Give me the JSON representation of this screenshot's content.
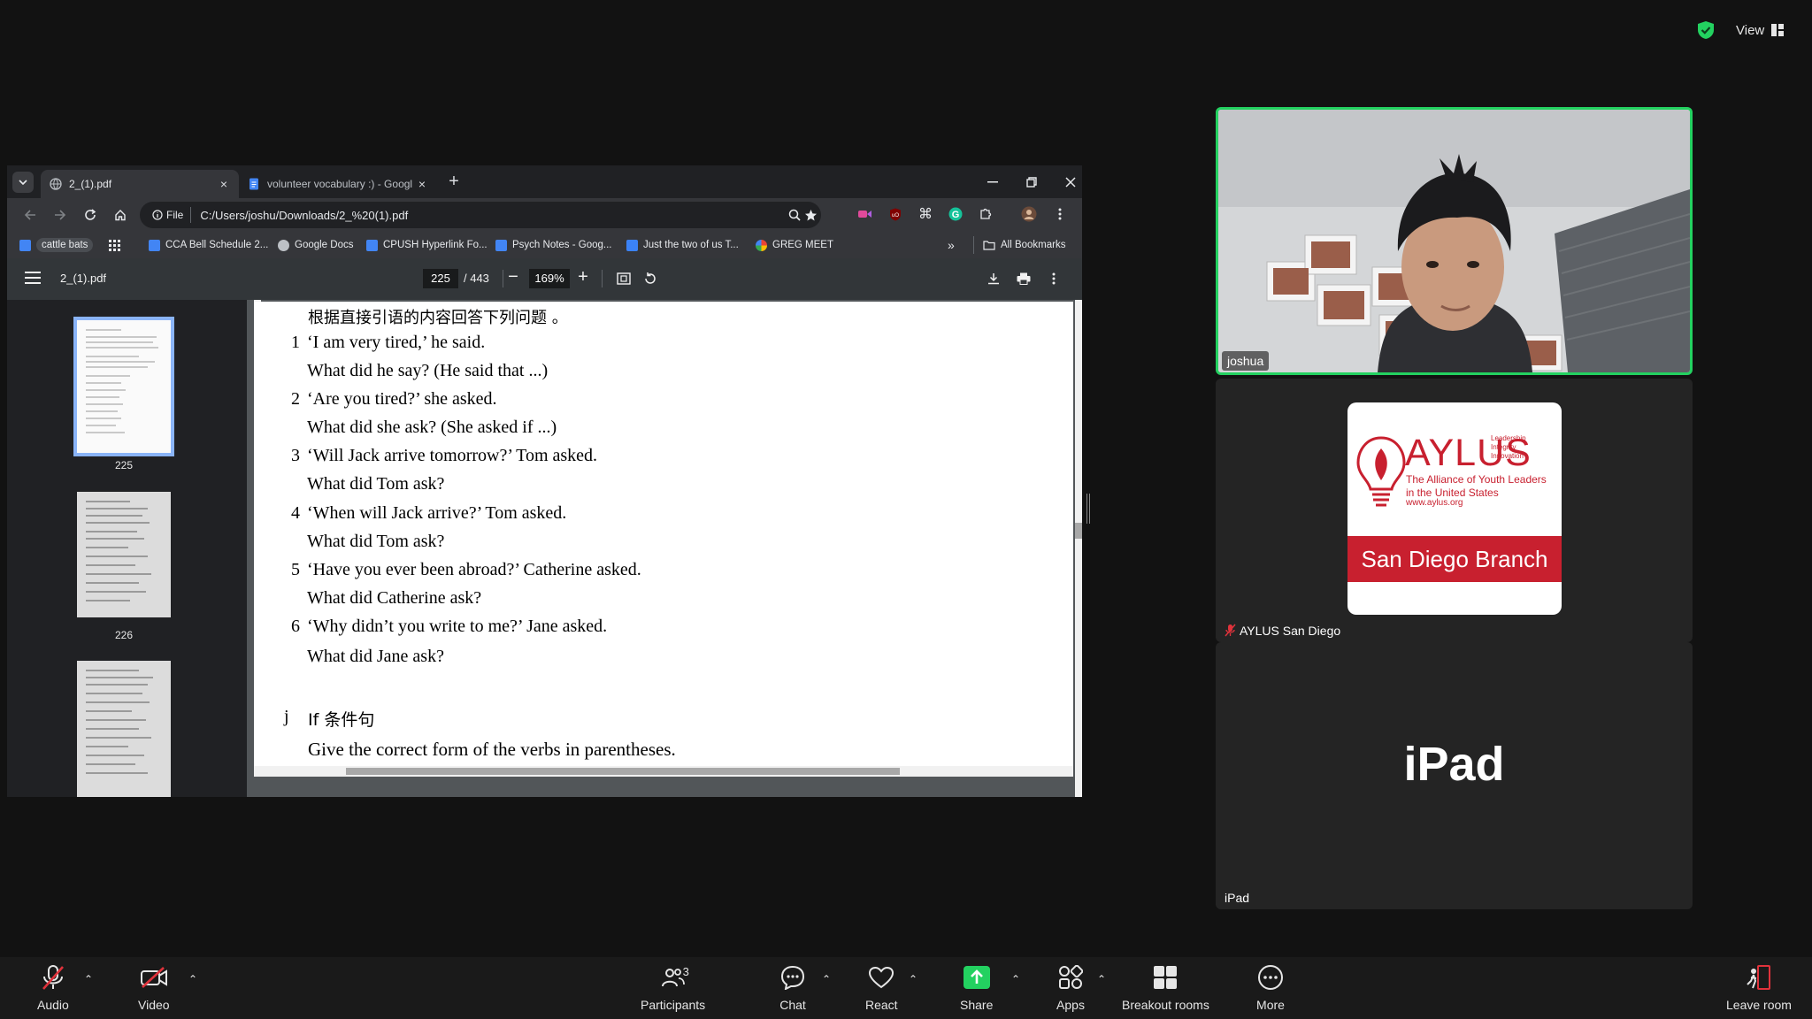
{
  "top_right": {
    "view_label": "View"
  },
  "browser": {
    "tabs": [
      {
        "title": "2_(1).pdf"
      },
      {
        "title": "volunteer vocabulary :) - Googl"
      }
    ],
    "omnibox": {
      "scheme_chip": "File",
      "url": "C:/Users/joshu/Downloads/2_%20(1).pdf"
    },
    "bookmarks": [
      "cattle bats",
      "CCA Bell Schedule 2...",
      "Google Docs",
      "CPUSH Hyperlink Fo...",
      "Psych Notes - Goog...",
      "Just the two of us T...",
      "GREG MEET"
    ],
    "all_bookmarks_label": "All Bookmarks",
    "more_bookmarks": "»"
  },
  "pdf": {
    "filename": "2_(1).pdf",
    "page_current": "225",
    "page_total": "/ 443",
    "zoom": "169%",
    "thumbnails": [
      "225",
      "226"
    ],
    "content": {
      "heading": "根据直接引语的内容回答下列问题 。",
      "items": [
        {
          "num": "1",
          "quote": "‘I am very tired,’ he said.",
          "question": "What did he say? (He said that ...)"
        },
        {
          "num": "2",
          "quote": "‘Are you tired?’ she asked.",
          "question": "What did she ask? (She asked if ...)"
        },
        {
          "num": "3",
          "quote": "‘Will Jack arrive tomorrow?’ Tom asked.",
          "question": "What did Tom ask?"
        },
        {
          "num": "4",
          "quote": "‘When will Jack arrive?’ Tom asked.",
          "question": "What did Tom ask?"
        },
        {
          "num": "5",
          "quote": "‘Have you ever been abroad?’ Catherine asked.",
          "question": "What did Catherine ask?"
        },
        {
          "num": "6",
          "quote": "‘Why didn’t you write to me?’ Jane asked.",
          "question": "What did Jane ask?"
        }
      ],
      "section_letter": "j",
      "section_title": "If 条件句",
      "instruction": "Give the correct form of the verbs in parentheses."
    }
  },
  "participants": {
    "camera": {
      "name": "joshua"
    },
    "aylus": {
      "name": "AYLUS San Diego",
      "logo_title": "AYLUS",
      "logo_tagline": [
        "Leadership",
        "Integrity",
        "Innovation"
      ],
      "logo_desc": [
        "The Alliance of Youth Leaders",
        "in the United States"
      ],
      "logo_url": "www.aylus.org",
      "logo_band": "San Diego Branch"
    },
    "ipad": {
      "name": "iPad",
      "big_label": "iPad"
    }
  },
  "meeting_toolbar": {
    "audio": "Audio",
    "video": "Video",
    "participants": "Participants",
    "participants_count": "3",
    "chat": "Chat",
    "react": "React",
    "share": "Share",
    "apps": "Apps",
    "breakout": "Breakout rooms",
    "more": "More",
    "leave": "Leave room"
  },
  "colors": {
    "active_speaker_border": "#23d160",
    "aylus_red": "#c8202f",
    "share_green": "#23d160",
    "muted_red": "#e0323b",
    "background": "#121212"
  }
}
